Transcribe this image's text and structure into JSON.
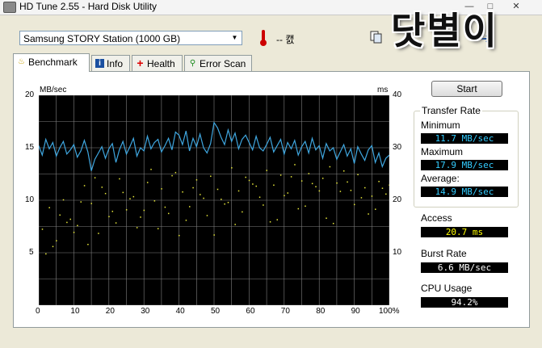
{
  "window": {
    "title": "HD Tune 2.55 - Hard Disk Utility",
    "minimize": "—",
    "maximize": "□",
    "close": "✕"
  },
  "watermark": "닷별이",
  "drive": {
    "selected": "Samsung STORY Station (1000 GB)"
  },
  "temperature": "-- 캜",
  "tabs": [
    {
      "label": "Benchmark",
      "icon": "gauge-icon"
    },
    {
      "label": "Info",
      "icon": "info-icon"
    },
    {
      "label": "Health",
      "icon": "health-cross-icon"
    },
    {
      "label": "Error Scan",
      "icon": "magnifier-icon"
    }
  ],
  "start_button": "Start",
  "transfer_rate": {
    "title": "Transfer Rate",
    "minimum_label": "Minimum",
    "minimum": "11.7 MB/sec",
    "maximum_label": "Maximum",
    "maximum": "17.9 MB/sec",
    "average_label": "Average:",
    "average": "14.9 MB/sec"
  },
  "access": {
    "label": "Access",
    "value": "20.7 ms"
  },
  "burst": {
    "label": "Burst Rate",
    "value": "6.6 MB/sec"
  },
  "cpu": {
    "label": "CPU Usage",
    "value": "94.2%"
  },
  "colors": {
    "line": "#3fa7e0",
    "scatter": "#e8e83a",
    "grid": "#808080",
    "access": "#ffff00",
    "rate": "#33ccff"
  },
  "chart_data": {
    "type": "line",
    "ylabel_left": "MB/sec",
    "ylabel_right": "ms",
    "left_ticks": [
      "20",
      "15",
      "10",
      "5"
    ],
    "right_ticks": [
      "40",
      "30",
      "20",
      "10"
    ],
    "x_ticks": [
      "0",
      "10",
      "20",
      "30",
      "40",
      "50",
      "60",
      "70",
      "80",
      "90",
      "100%"
    ],
    "ylim_left": [
      0,
      20
    ],
    "ylim_right": [
      0,
      40
    ],
    "xlim": [
      0,
      100
    ],
    "grid": true,
    "series": [
      {
        "type": "line",
        "x": [
          0,
          1,
          2,
          3,
          4,
          5,
          6,
          7,
          8,
          9,
          10,
          11,
          12,
          13,
          14,
          15,
          16,
          17,
          18,
          19,
          20,
          21,
          22,
          23,
          24,
          25,
          26,
          27,
          28,
          29,
          30,
          31,
          32,
          33,
          34,
          35,
          36,
          37,
          38,
          39,
          40,
          41,
          42,
          43,
          44,
          45,
          46,
          47,
          48,
          49,
          50,
          51,
          52,
          53,
          54,
          55,
          56,
          57,
          58,
          59,
          60,
          61,
          62,
          63,
          64,
          65,
          66,
          67,
          68,
          69,
          70,
          71,
          72,
          73,
          74,
          75,
          76,
          77,
          78,
          79,
          80,
          81,
          82,
          83,
          84,
          85,
          86,
          87,
          88,
          89,
          90,
          91,
          92,
          93,
          94,
          95,
          96,
          97,
          98,
          99,
          100
        ],
        "values": [
          15.2,
          14.3,
          15.8,
          14.9,
          15.5,
          14.2,
          15.0,
          15.6,
          14.4,
          14.8,
          15.3,
          14.1,
          14.7,
          15.7,
          14.6,
          12.8,
          13.9,
          14.5,
          15.1,
          14.0,
          14.9,
          15.4,
          13.6,
          14.8,
          15.6,
          14.4,
          15.1,
          15.9,
          14.2,
          15.0,
          14.7,
          16.1,
          14.9,
          15.5,
          15.8,
          14.6,
          15.2,
          15.9,
          14.8,
          16.5,
          16.2,
          15.3,
          16.6,
          14.7,
          15.9,
          15.1,
          16.3,
          15.0,
          14.5,
          15.4,
          17.4,
          16.9,
          16.0,
          15.3,
          16.7,
          15.6,
          16.4,
          14.9,
          15.8,
          16.2,
          15.5,
          14.8,
          16.1,
          15.0,
          14.7,
          15.3,
          16.0,
          14.6,
          15.2,
          15.8,
          14.4,
          15.5,
          14.9,
          15.7,
          14.3,
          15.1,
          15.6,
          14.5,
          15.9,
          14.8,
          15.2,
          14.0,
          15.4,
          14.7,
          15.0,
          13.9,
          14.6,
          15.3,
          14.2,
          14.9,
          13.5,
          15.1,
          14.4,
          13.8,
          14.8,
          15.2,
          13.6,
          14.5,
          13.2,
          14.0,
          14.3
        ]
      }
    ],
    "access_scatter": {
      "axis": "ms",
      "x": [
        1,
        3,
        5,
        7,
        9,
        11,
        13,
        15,
        17,
        19,
        21,
        23,
        25,
        27,
        29,
        31,
        33,
        35,
        37,
        39,
        41,
        43,
        45,
        47,
        49,
        51,
        53,
        55,
        57,
        59,
        61,
        63,
        65,
        67,
        69,
        71,
        73,
        75,
        77,
        79,
        81,
        83,
        85,
        87,
        89,
        91,
        93,
        95,
        97,
        99,
        2,
        6,
        10,
        14,
        18,
        22,
        26,
        30,
        34,
        38,
        42,
        46,
        50,
        54,
        58,
        62,
        66,
        70,
        74,
        78,
        82,
        86,
        90,
        94,
        98,
        4,
        8,
        12,
        16,
        20,
        24,
        28,
        32,
        36,
        40,
        44,
        48,
        52,
        56,
        60,
        64,
        68,
        72,
        76,
        80,
        84,
        88,
        92,
        96,
        100
      ],
      "values": [
        14.5,
        18.6,
        12.3,
        20.1,
        16.4,
        15.2,
        22.8,
        19.4,
        13.7,
        21.3,
        17.9,
        24.1,
        18.2,
        20.7,
        16.8,
        23.4,
        19.9,
        22.2,
        17.5,
        25.3,
        21.6,
        18.8,
        23.9,
        20.4,
        24.6,
        22.1,
        19.3,
        26.2,
        21.8,
        24.4,
        23.1,
        20.6,
        25.7,
        22.9,
        24.8,
        21.4,
        26.8,
        23.7,
        25.1,
        22.6,
        24.2,
        26.4,
        23.3,
        25.6,
        21.9,
        24.9,
        22.4,
        20.8,
        23.6,
        21.2,
        9.8,
        17.2,
        13.9,
        11.6,
        22.5,
        15.7,
        20.3,
        18.1,
        14.6,
        24.7,
        16.2,
        21.1,
        13.4,
        19.6,
        17.8,
        22.7,
        15.9,
        20.9,
        18.4,
        23.2,
        16.6,
        21.7,
        19.2,
        17.4,
        22.3,
        11.2,
        15.8,
        19.7,
        24.3,
        16.9,
        21.5,
        14.8,
        25.9,
        18.7,
        13.3,
        22.4,
        17.1,
        20.2,
        15.4,
        23.8,
        19.1,
        16.3,
        24.5,
        18.9,
        21.8,
        15.6,
        23.5,
        20.5,
        18.3,
        22.9
      ]
    }
  }
}
